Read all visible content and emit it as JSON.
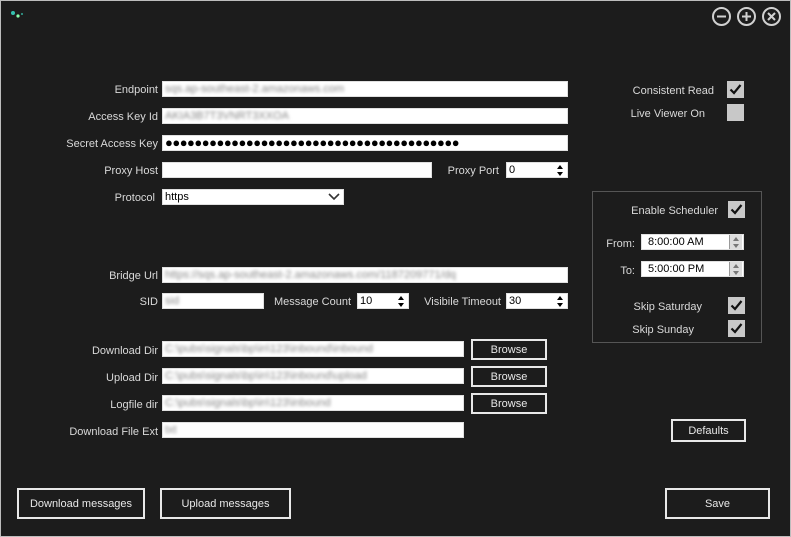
{
  "window_controls": {
    "minimize": "minimize",
    "maximize": "maximize",
    "close": "close"
  },
  "form": {
    "endpoint": {
      "label": "Endpoint",
      "value": "sqs.ap-southeast-2.amazonaws.com"
    },
    "access_key_id": {
      "label": "Access Key Id",
      "value": "AKIA3B7T3VNRT3XXOA"
    },
    "secret_access_key": {
      "label": "Secret Access Key",
      "value": "●●●●●●●●●●●●●●●●●●●●●●●●●●●●●●●●●●●●●●●●"
    },
    "proxy_host": {
      "label": "Proxy Host",
      "value": ""
    },
    "proxy_port": {
      "label": "Proxy Port",
      "value": "0"
    },
    "protocol": {
      "label": "Protocol",
      "value": "https"
    },
    "bridge_url": {
      "label": "Bridge Url",
      "value": "https://sqs.ap-southeast-2.amazonaws.com/1187209771/dq"
    },
    "sid": {
      "label": "SID",
      "value": "sid"
    },
    "message_count": {
      "label": "Message Count",
      "value": "10"
    },
    "visibility_timeout": {
      "label": "Visibile Timeout",
      "value": "30"
    },
    "download_dir": {
      "label": "Download Dir",
      "value": "C:\\pubs\\signals\\bp\\in\\123\\inbound\\inbound"
    },
    "upload_dir": {
      "label": "Upload Dir",
      "value": "C:\\pubs\\signals\\bp\\in\\123\\inbound\\upload"
    },
    "logfile_dir": {
      "label": "Logfile dir",
      "value": "C:\\pubs\\signals\\bp\\in\\123\\inbound"
    },
    "download_file_ext": {
      "label": "Download File Ext",
      "value": "txt"
    },
    "browse_label": "Browse"
  },
  "options": {
    "consistent_read": {
      "label": "Consistent Read",
      "checked": true
    },
    "live_viewer_on": {
      "label": "Live Viewer On",
      "checked": false
    }
  },
  "scheduler": {
    "enable": {
      "label": "Enable Scheduler",
      "checked": true
    },
    "from": {
      "label": "From:",
      "value": "8:00:00 AM"
    },
    "to": {
      "label": "To:",
      "value": "5:00:00 PM"
    },
    "skip_saturday": {
      "label": "Skip Saturday",
      "checked": true
    },
    "skip_sunday": {
      "label": "Skip Sunday",
      "checked": true
    }
  },
  "buttons": {
    "defaults": "Defaults",
    "download_messages": "Download messages",
    "upload_messages": "Upload messages",
    "save": "Save"
  },
  "colors": {
    "background": "#1c1c1c",
    "border": "#e8e8e8",
    "checkbox": "#c8c8c8"
  }
}
